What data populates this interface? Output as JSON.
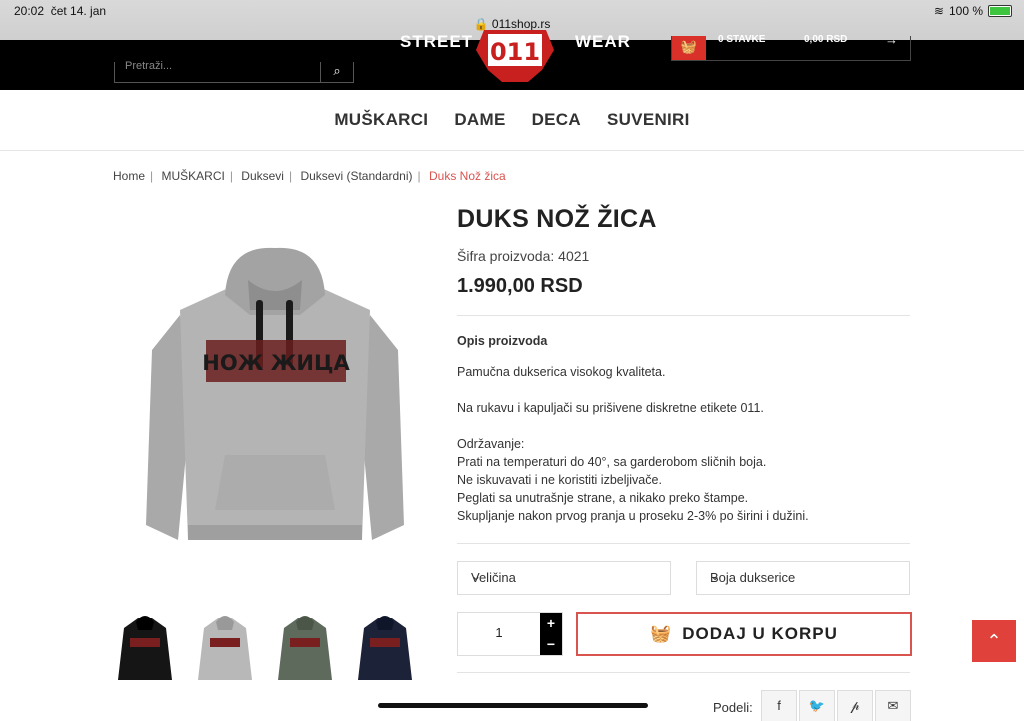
{
  "status": {
    "time": "20:02",
    "date": "čet 14. jan",
    "url": "011shop.rs",
    "battery": "100 %"
  },
  "header": {
    "search_placeholder": "Pretraži...",
    "brand_left": "STREET",
    "brand_right": "WEAR",
    "logo_text": "011",
    "cart_count": "0 STAVKE",
    "cart_total": "0,00 RSD"
  },
  "nav": [
    "MUŠKARCI",
    "DAME",
    "DECA",
    "SUVENIRI"
  ],
  "breadcrumb": [
    "Home",
    "MUŠKARCI",
    "Duksevi",
    "Duksevi (Standardni)",
    "Duks Nož žica"
  ],
  "product": {
    "title": "DUKS NOŽ ŽICA",
    "sku": "Šifra proizvoda: 4021",
    "price": "1.990,00 RSD",
    "print_text": "НОЖ ЖИЦА",
    "desc_heading": "Opis proizvoda",
    "desc_lines": [
      "Pamučna dukserica visokog kvaliteta.",
      "Na rukavu i kapuljači su prišivene diskretne etikete 011.",
      "Održavanje:",
      "Prati na temperaturi do 40°, sa garderobom sličnih boja.",
      "Ne iskuvavati i ne koristiti izbeljivače.",
      "Peglati sa unutrašnje strane, a nikako preko štampe.",
      "Skupljanje nakon prvog pranja u proseku 2-3% po širini i dužini."
    ],
    "size_label": "Veličina",
    "color_label": "Boja dukserice",
    "quantity": "1",
    "add_to_cart": "DODAJ U KORPU",
    "share_label": "Podeli:"
  },
  "thumb_colors": [
    "#151515",
    "#b8b8b8",
    "#5e6a5c",
    "#1c2238"
  ],
  "colors": {
    "accent": "#d9534f",
    "header_bg": "#000000"
  }
}
